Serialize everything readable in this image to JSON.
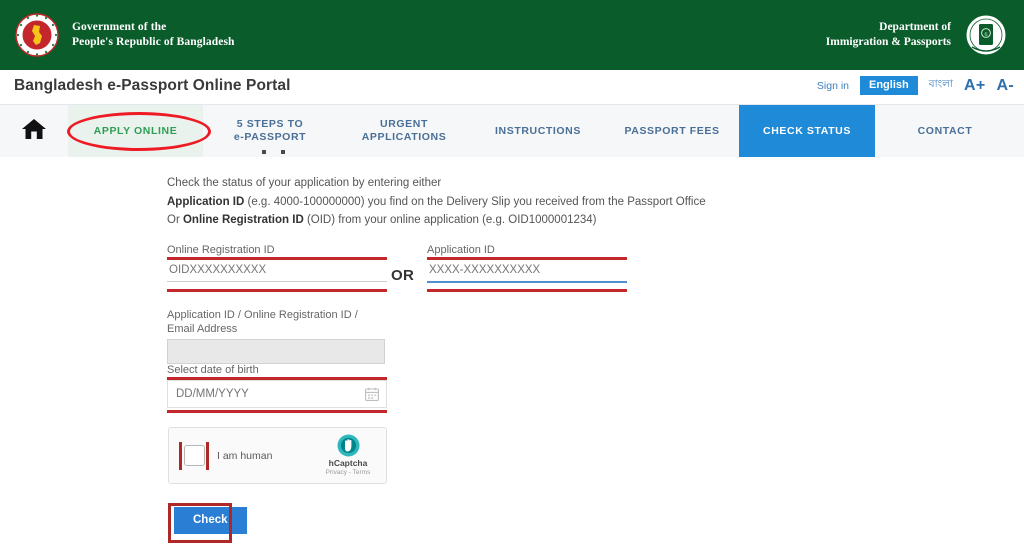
{
  "gov_header": {
    "left_line1": "Government of the",
    "left_line2": "People's Republic of Bangladesh",
    "right_line1": "Department of",
    "right_line2": "Immigration & Passports",
    "emblem_icon": "bangladesh-national-emblem",
    "seal_icon": "immigration-passports-seal",
    "bg_color": "#0a5c2b"
  },
  "titlebar": {
    "portal_title": "Bangladesh e-Passport Online Portal",
    "sign_in": "Sign in",
    "lang_english": "English",
    "lang_bangla": "বাংলা",
    "font_increase": "A+",
    "font_decrease": "A-",
    "active_lang_color": "#1f8bd8"
  },
  "nav": {
    "home_icon": "home-icon",
    "items": [
      {
        "label": "APPLY ONLINE",
        "state": "highlighted"
      },
      {
        "label": "5 STEPS TO\ne-PASSPORT",
        "line1": "5 STEPS TO",
        "line2": "e-PASSPORT",
        "state": "default"
      },
      {
        "label": "URGENT\nAPPLICATIONS",
        "line1": "URGENT",
        "line2": "APPLICATIONS",
        "state": "default"
      },
      {
        "label": "INSTRUCTIONS",
        "state": "default"
      },
      {
        "label": "PASSPORT FEES",
        "state": "default"
      },
      {
        "label": "CHECK STATUS",
        "state": "active"
      },
      {
        "label": "CONTACT",
        "state": "default"
      }
    ],
    "active_bg": "#1f8bd8",
    "apply_online_bg": "#e9f2ec",
    "apply_online_color": "#2f9e54"
  },
  "instructions": {
    "line1": "Check the status of your application by entering either",
    "line2_bold": "Application ID",
    "line2_rest": " (e.g. 4000-100000000) you find on the Delivery Slip you received from the Passport Office",
    "line3_prefix": "Or ",
    "line3_bold": "Online Registration ID",
    "line3_rest": " (OID) from your online application (e.g. OID1000001234)"
  },
  "form": {
    "oid_label": "Online Registration ID",
    "oid_placeholder": "OIDXXXXXXXXXX",
    "oid_value": "",
    "or_separator": "OR",
    "appid_label": "Application ID",
    "appid_placeholder": "XXXX-XXXXXXXXXX",
    "appid_value": "",
    "combo_label": "Application ID / Online Registration ID / Email Address",
    "combo_placeholder": "",
    "combo_value": "",
    "dob_label": "Select date of birth",
    "dob_placeholder": "DD/MM/YYYY",
    "dob_value": "",
    "calendar_icon": "calendar-icon",
    "submit_label": "Check",
    "submit_color": "#2a7fd4"
  },
  "captcha": {
    "checkbox_label": "I am human",
    "brand_name": "hCaptcha",
    "links": "Privacy - Terms",
    "logo_icon": "hcaptcha-hand-icon",
    "logo_color": "#00858a",
    "checked": false
  },
  "annotations": {
    "color_red": "#b02727",
    "ellipse_color": "#ee1b24",
    "targets": [
      "apply-online-nav",
      "oid-field",
      "appid-field",
      "dob-field",
      "captcha-checkbox",
      "check-button"
    ]
  }
}
